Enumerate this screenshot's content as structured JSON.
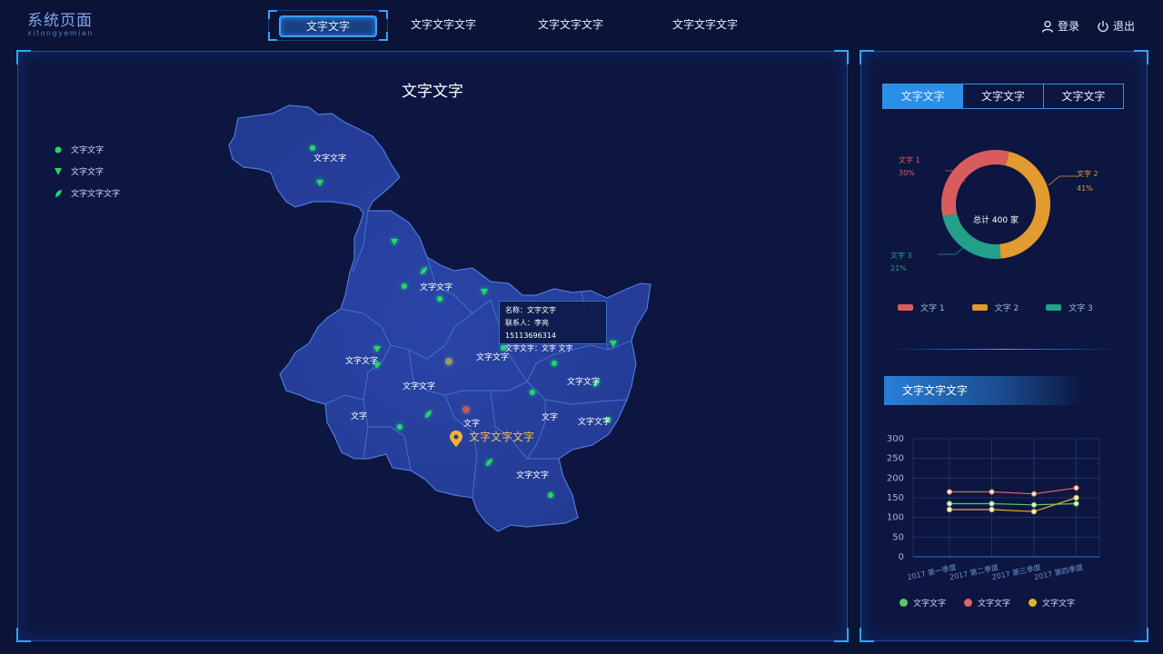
{
  "brand": {
    "title": "系统页面",
    "subtitle": "xitongyemian"
  },
  "nav": {
    "tabs": [
      "文字文字",
      "文字文字文字",
      "文字文字文字",
      "文字文字文字"
    ]
  },
  "header": {
    "login": "登录",
    "logout": "退出"
  },
  "map": {
    "title": "文字文字",
    "legend": [
      "文字文字",
      "文字文字",
      "文字文字文字"
    ],
    "labels": [
      "文字文字",
      "文字文字",
      "文字文字",
      "文字文字",
      "文字文字",
      "文字",
      "文字",
      "文字",
      "文字文字",
      "文字文字",
      "文字文字"
    ],
    "marker_label": "文字文字文字",
    "tooltip": {
      "line1": "名称：文字文字",
      "line2": "联系人：李亮  15113696314",
      "line3": "文字文字：文字     文字"
    }
  },
  "side": {
    "tabs": [
      "文字文字",
      "文字文字",
      "文字文字"
    ],
    "section_title": "文字文字文字"
  },
  "colors": {
    "green": "#22d86a",
    "red": "#d95c5c",
    "orange": "#e39a2e",
    "teal": "#22a088",
    "accent": "#2a8fe6"
  },
  "chart_data": [
    {
      "type": "pie",
      "center_label": "总计 400 家",
      "labels": [
        "文字 1",
        "文字 2",
        "文字 3"
      ],
      "values": [
        30,
        41,
        21
      ],
      "value_labels": [
        "30%",
        "41%",
        "21%"
      ],
      "colors": [
        "#d95c5c",
        "#e39a2e",
        "#22a088"
      ]
    },
    {
      "type": "line",
      "categories": [
        "2017 第一季度",
        "2017 第二季度",
        "2017 第三季度",
        "2017 第四季度"
      ],
      "yticks": [
        "0",
        "50",
        "100",
        "150",
        "200",
        "250",
        "300"
      ],
      "ylim": [
        0,
        300
      ],
      "series": [
        {
          "name": "文字文字",
          "color": "#5fc46a",
          "values": [
            135,
            135,
            132,
            135
          ]
        },
        {
          "name": "文字文字",
          "color": "#e06464",
          "values": [
            165,
            165,
            160,
            175
          ]
        },
        {
          "name": "文字文字",
          "color": "#e3b032",
          "values": [
            120,
            120,
            115,
            150
          ]
        }
      ]
    }
  ]
}
